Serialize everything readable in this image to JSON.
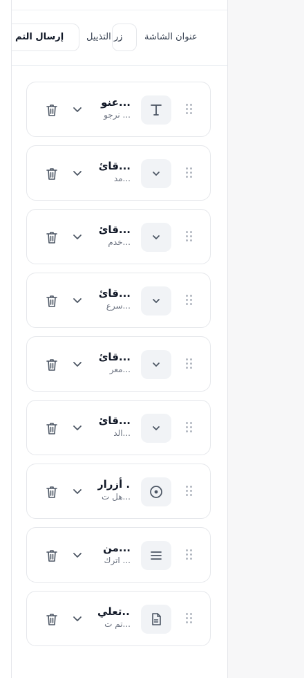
{
  "header": {
    "screen_title_label": "عنوان الشاشة",
    "footer_button_label": "زر التذييل",
    "footer_button_value": "ز",
    "submit_value": "إرسال التم"
  },
  "fields": [
    {
      "icon": "text-icon",
      "title": "عنو...",
      "subtitle": "نرجو ..."
    },
    {
      "icon": "chevron-down-icon",
      "title": "قائ...",
      "subtitle": "مد..."
    },
    {
      "icon": "chevron-down-icon",
      "title": "قائ...",
      "subtitle": "خدم..."
    },
    {
      "icon": "chevron-down-icon",
      "title": "قائ...",
      "subtitle": "سرع..."
    },
    {
      "icon": "chevron-down-icon",
      "title": "قائ...",
      "subtitle": "معر..."
    },
    {
      "icon": "chevron-down-icon",
      "title": "قائ...",
      "subtitle": "الد..."
    },
    {
      "icon": "radio-icon",
      "title": "أزرار ...",
      "subtitle": "هل ت..."
    },
    {
      "icon": "paragraph-icon",
      "title": "من...",
      "subtitle": "اترك ..."
    },
    {
      "icon": "document-icon",
      "title": "تعلي...",
      "subtitle": "تم ت..."
    }
  ]
}
